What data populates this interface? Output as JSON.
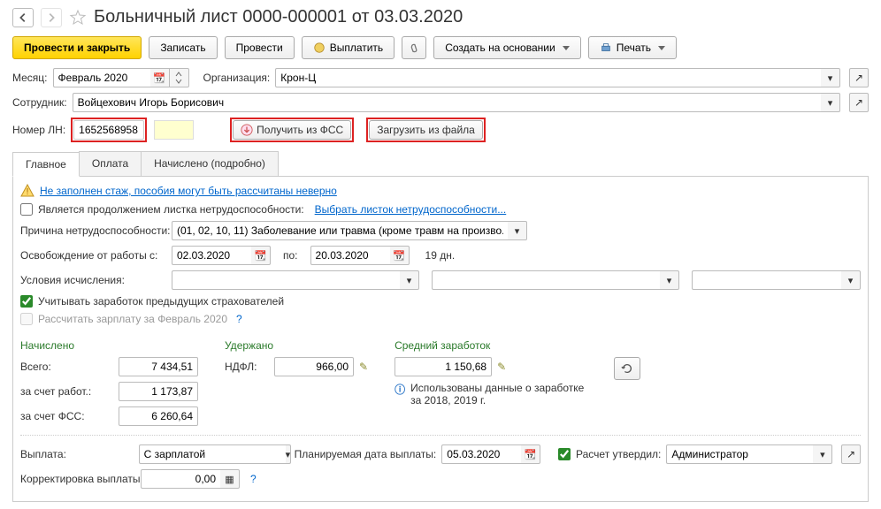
{
  "header": {
    "title": "Больничный лист 0000-000001 от 03.03.2020"
  },
  "toolbar": {
    "post_close": "Провести и закрыть",
    "save": "Записать",
    "post": "Провести",
    "pay": "Выплатить",
    "create_based": "Создать на основании",
    "print": "Печать"
  },
  "month": {
    "label": "Месяц:",
    "value": "Февраль 2020"
  },
  "org": {
    "label": "Организация:",
    "value": "Крон-Ц"
  },
  "employee": {
    "label": "Сотрудник:",
    "value": "Войцехович Игорь Борисович"
  },
  "ln": {
    "label": "Номер ЛН:",
    "value": "1652568958"
  },
  "fss_btn": "Получить из ФСС",
  "file_btn": "Загрузить из файла",
  "tabs": {
    "main": "Главное",
    "payment": "Оплата",
    "calc": "Начислено (подробно)"
  },
  "warning": "Не заполнен стаж, пособия могут быть рассчитаны неверно",
  "continuation": {
    "label": "Является продолжением листка нетрудоспособности:",
    "link": "Выбрать листок нетрудоспособности..."
  },
  "reason": {
    "label": "Причина нетрудоспособности:",
    "value": "(01, 02, 10, 11) Заболевание или травма (кроме травм на произво..."
  },
  "absence": {
    "label": "Освобождение от работы с:",
    "from": "02.03.2020",
    "to_label": "по:",
    "to": "20.03.2020",
    "days": "19 дн."
  },
  "conditions": {
    "label": "Условия исчисления:"
  },
  "prev_insurers": "Учитывать заработок предыдущих страхователей",
  "calc_salary": "Рассчитать зарплату за Февраль 2020",
  "accrued": {
    "title": "Начислено",
    "total_label": "Всего:",
    "total": "7 434,51",
    "employer_label": "за счет работ.:",
    "employer": "1 173,87",
    "fss_label": "за счет ФСС:",
    "fss": "6 260,64"
  },
  "withheld": {
    "title": "Удержано",
    "ndfl_label": "НДФЛ:",
    "ndfl": "966,00"
  },
  "avg_earn": {
    "title": "Средний заработок",
    "value": "1 150,68",
    "info": "Использованы данные о заработке за 2018,  2019 г."
  },
  "payout": {
    "label": "Выплата:",
    "value": "С зарплатой",
    "date_label": "Планируемая дата выплаты:",
    "date": "05.03.2020",
    "approved": "Расчет утвердил:",
    "approver": "Администратор"
  },
  "correction": {
    "label": "Корректировка выплаты:",
    "value": "0,00"
  }
}
